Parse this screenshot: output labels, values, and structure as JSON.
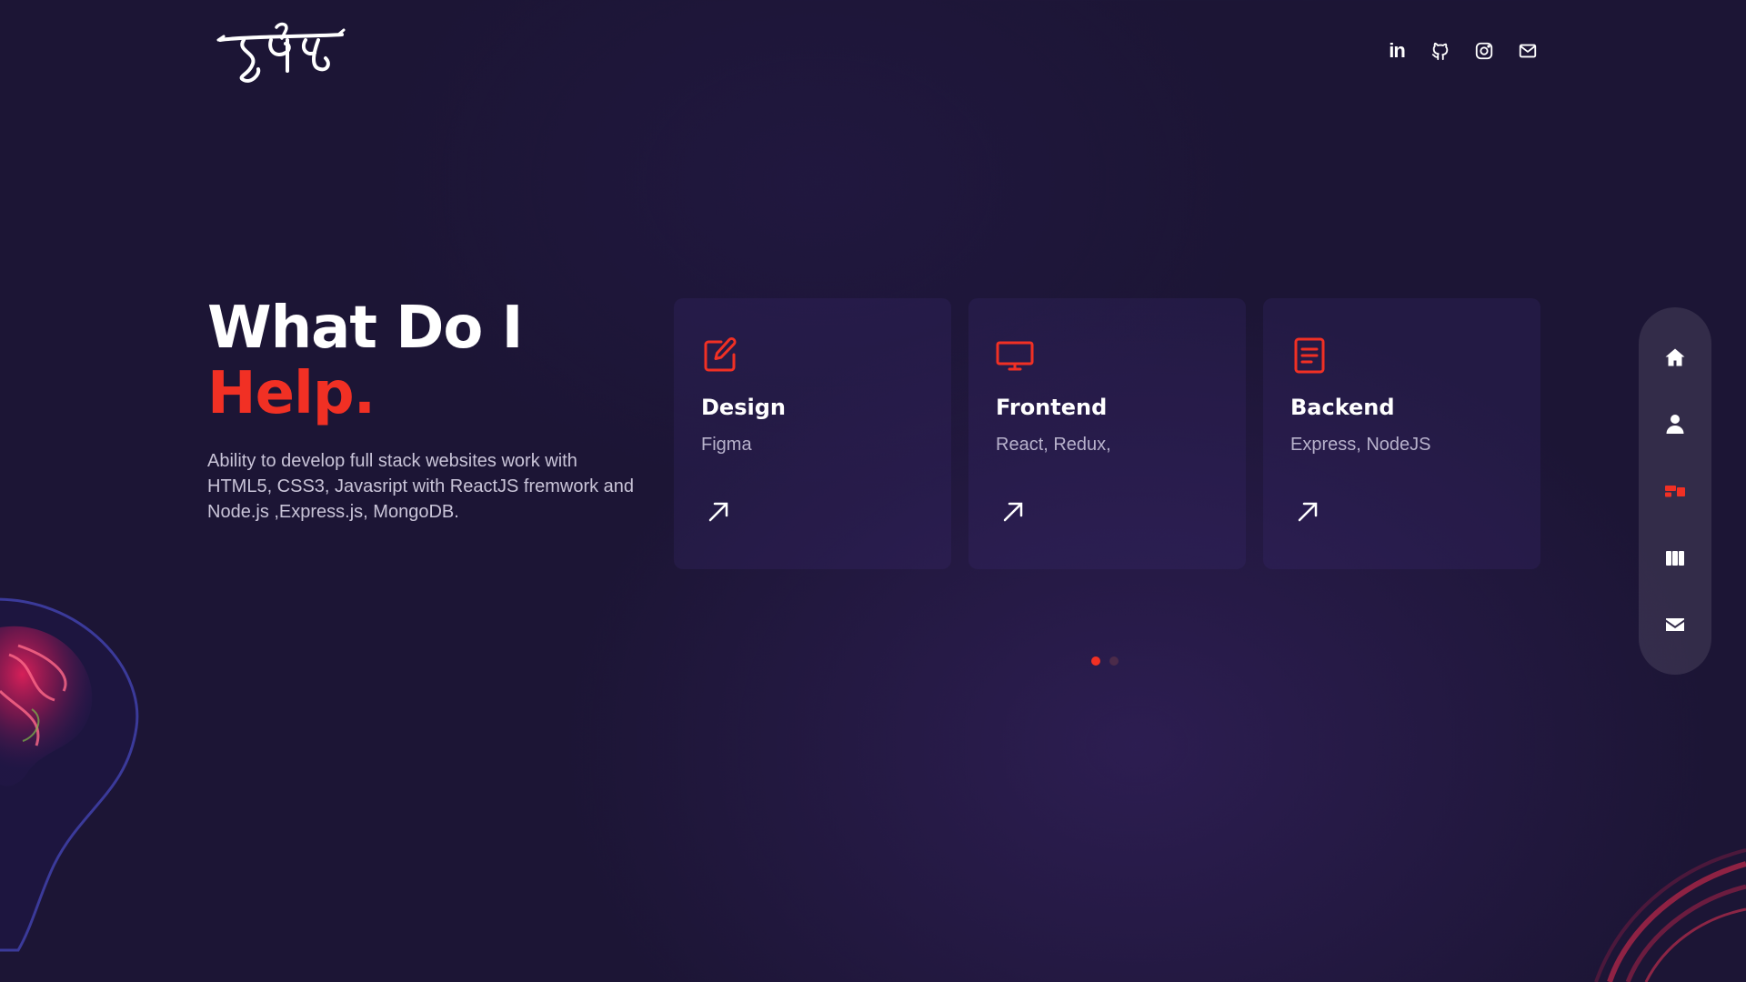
{
  "header": {
    "logo_text": "हर्षल",
    "socials": [
      {
        "name": "LinkedIn",
        "icon": "linkedin-icon"
      },
      {
        "name": "GitHub",
        "icon": "github-icon"
      },
      {
        "name": "Instagram",
        "icon": "instagram-icon"
      },
      {
        "name": "Email",
        "icon": "mail-icon"
      }
    ]
  },
  "hero": {
    "title_line1": "What Do I",
    "title_line2": "Help.",
    "description": "Ability to develop full stack websites work with HTML5, CSS3, Javasript with ReactJS fremwork and Node.js ,Express.js, MongoDB."
  },
  "services": [
    {
      "title": "Design",
      "description": "Figma",
      "icon": "edit-icon"
    },
    {
      "title": "Frontend",
      "description": "React, Redux,",
      "icon": "monitor-icon"
    },
    {
      "title": "Backend",
      "description": "Express, NodeJS",
      "icon": "document-icon"
    }
  ],
  "pagination": {
    "total": 2,
    "active": 1
  },
  "sidenav": [
    {
      "name": "Home",
      "icon": "home-icon",
      "active": false
    },
    {
      "name": "About",
      "icon": "user-icon",
      "active": false
    },
    {
      "name": "Services",
      "icon": "services-icon",
      "active": true
    },
    {
      "name": "Work",
      "icon": "columns-icon",
      "active": false
    },
    {
      "name": "Contact",
      "icon": "envelope-icon",
      "active": false
    }
  ],
  "colors": {
    "background": "#1c1535",
    "accent": "#f13024",
    "card": "#2a1f4f",
    "text_muted": "#c9c4d8"
  }
}
